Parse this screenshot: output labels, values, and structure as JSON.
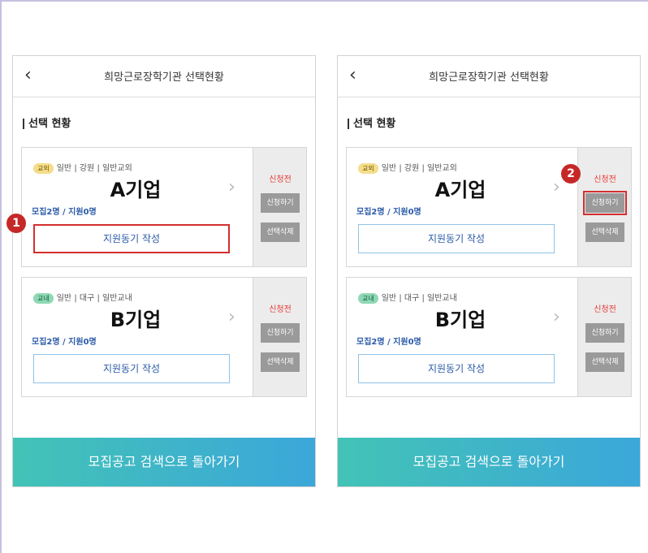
{
  "screens": [
    {
      "header_title": "희망근로장학기관 선택현황",
      "section_title": "선택 현황",
      "cards": [
        {
          "tag": "교외",
          "meta": "일반 | 강원 | 일반교외",
          "company": "A기업",
          "count": "모집2명 / 지원0명",
          "motive_label": "지원동기 작성",
          "status": "신청전",
          "apply_label": "신청하기",
          "delete_label": "선택삭제"
        },
        {
          "tag": "교내",
          "meta": "일반 | 대구 | 일반교내",
          "company": "B기업",
          "count": "모집2명 / 지원0명",
          "motive_label": "지원동기 작성",
          "status": "신청전",
          "apply_label": "신청하기",
          "delete_label": "선택삭제"
        }
      ],
      "footer_label": "모집공고 검색으로 돌아가기",
      "marker": "1"
    },
    {
      "header_title": "희망근로장학기관 선택현황",
      "section_title": "선택 현황",
      "cards": [
        {
          "tag": "교외",
          "meta": "일반 | 강원 | 일반교외",
          "company": "A기업",
          "count": "모집2명 / 지원0명",
          "motive_label": "지원동기 작성",
          "status": "신청전",
          "apply_label": "신청하기",
          "delete_label": "선택삭제"
        },
        {
          "tag": "교내",
          "meta": "일반 | 대구 | 일반교내",
          "company": "B기업",
          "count": "모집2명 / 지원0명",
          "motive_label": "지원동기 작성",
          "status": "신청전",
          "apply_label": "신청하기",
          "delete_label": "선택삭제"
        }
      ],
      "footer_label": "모집공고 검색으로 돌아가기",
      "marker": "2"
    }
  ],
  "icons": {
    "back": "chevron-left-icon",
    "card_arrow": "chevron-right-icon"
  },
  "colors": {
    "highlight": "#d32f2f",
    "status": "#e53935",
    "accent": "#2a5aa8",
    "footer_start": "#43c3b6",
    "footer_end": "#3ba7da"
  }
}
